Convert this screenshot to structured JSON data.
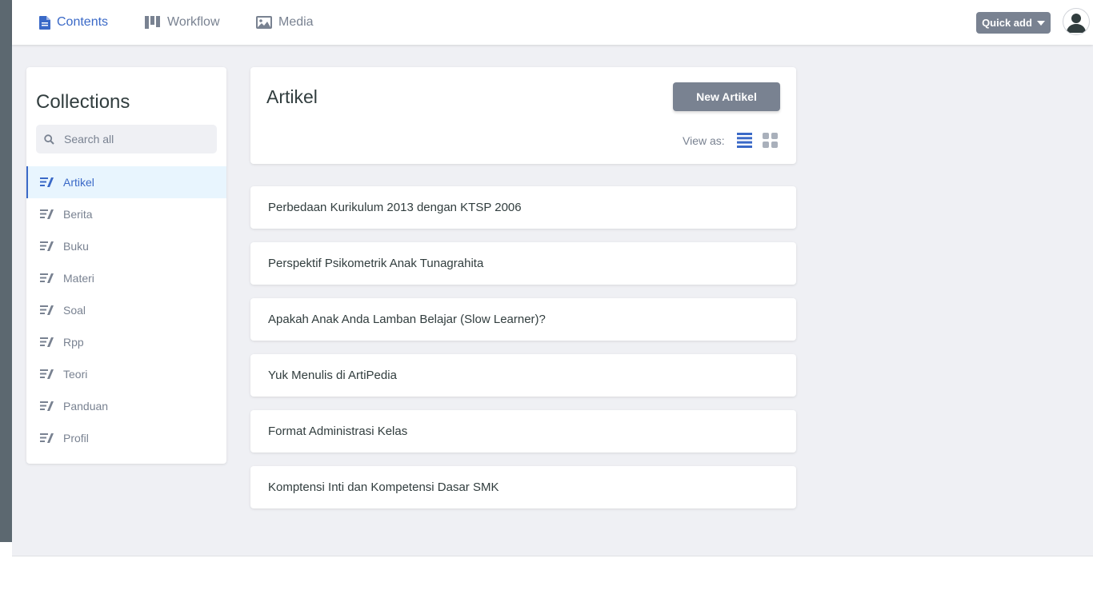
{
  "topnav": {
    "contents_label": "Contents",
    "workflow_label": "Workflow",
    "media_label": "Media",
    "quick_add_label": "Quick add",
    "accent_color": "#3a69c7"
  },
  "sidebar": {
    "title": "Collections",
    "search_placeholder": "Search all",
    "items": [
      {
        "label": "Artikel",
        "active": true
      },
      {
        "label": "Berita"
      },
      {
        "label": "Buku"
      },
      {
        "label": "Materi"
      },
      {
        "label": "Soal"
      },
      {
        "label": "Rpp"
      },
      {
        "label": "Teori"
      },
      {
        "label": "Panduan"
      },
      {
        "label": "Profil"
      }
    ]
  },
  "main": {
    "title": "Artikel",
    "new_button_label": "New Artikel",
    "view_as_label": "View as:",
    "entries": [
      "Perbedaan Kurikulum 2013 dengan KTSP 2006",
      "Perspektif Psikometrik Anak Tunagrahita",
      "Apakah Anak Anda Lamban Belajar (Slow Learner)?",
      "Yuk Menulis di ArtiPedia",
      "Format Administrasi Kelas",
      "Komptensi Inti dan Kompetensi Dasar SMK"
    ]
  }
}
